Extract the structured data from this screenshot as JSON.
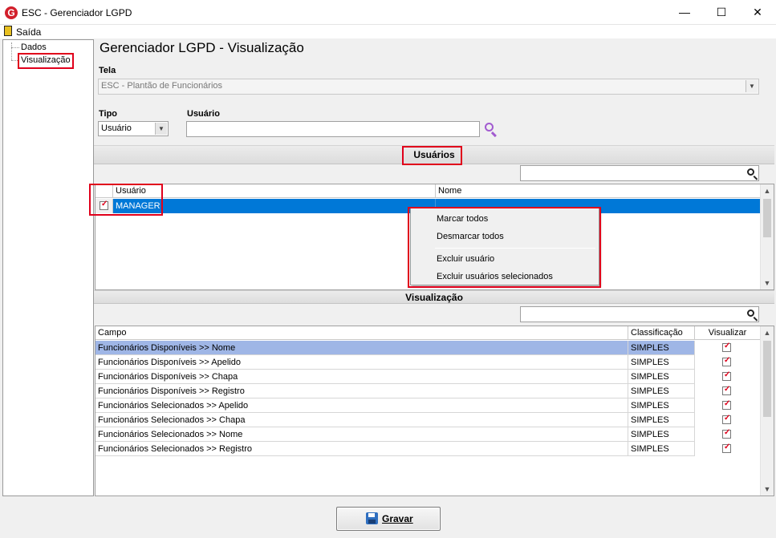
{
  "window": {
    "title": "ESC - Gerenciador LGPD",
    "icon_letter": "G",
    "minimize": "—",
    "maximize": "☐",
    "close": "✕"
  },
  "menu": {
    "exit_label": "Saída"
  },
  "tree": {
    "items": [
      {
        "label": "Dados"
      },
      {
        "label": "Visualização",
        "selected": true
      }
    ]
  },
  "page_title": "Gerenciador LGPD - Visualização",
  "tela": {
    "label": "Tela",
    "value": "ESC - Plantão de Funcionários"
  },
  "tipo": {
    "label": "Tipo",
    "value": "Usuário"
  },
  "usuario": {
    "label": "Usuário",
    "value": ""
  },
  "usuarios_section": {
    "title": "Usuários",
    "search_value": "",
    "columns": [
      "Usuário",
      "Nome"
    ],
    "rows": [
      {
        "checked": true,
        "usuario": "MANAGER",
        "nome": ""
      }
    ]
  },
  "context_menu": {
    "items": [
      "Marcar todos",
      "Desmarcar todos",
      "Excluir usuário",
      "Excluir usuários selecionados"
    ]
  },
  "visualizacao_section": {
    "title": "Visualização",
    "search_value": "",
    "columns": [
      "Campo",
      "Classificação",
      "Visualizar"
    ],
    "rows": [
      {
        "campo": "Funcionários Disponíveis >> Nome",
        "classificacao": "SIMPLES",
        "visualizar": true
      },
      {
        "campo": "Funcionários Disponíveis >> Apelido",
        "classificacao": "SIMPLES",
        "visualizar": true
      },
      {
        "campo": "Funcionários Disponíveis >> Chapa",
        "classificacao": "SIMPLES",
        "visualizar": true
      },
      {
        "campo": "Funcionários Disponíveis >> Registro",
        "classificacao": "SIMPLES",
        "visualizar": true
      },
      {
        "campo": "Funcionários Selecionados >> Apelido",
        "classificacao": "SIMPLES",
        "visualizar": true
      },
      {
        "campo": "Funcionários Selecionados >> Chapa",
        "classificacao": "SIMPLES",
        "visualizar": true
      },
      {
        "campo": "Funcionários Selecionados >> Nome",
        "classificacao": "SIMPLES",
        "visualizar": true
      },
      {
        "campo": "Funcionários Selecionados >> Registro",
        "classificacao": "SIMPLES",
        "visualizar": true
      }
    ]
  },
  "save_button": {
    "label": "Gravar"
  },
  "colors": {
    "selection": "#0078d7",
    "highlight_row": "#9fb6e6",
    "annotation": "#e0001b",
    "search_icon": "#a25bd0"
  },
  "icons": [
    "app-logo-icon",
    "exit-icon",
    "search-icon",
    "save-icon",
    "checkbox-icon"
  ]
}
